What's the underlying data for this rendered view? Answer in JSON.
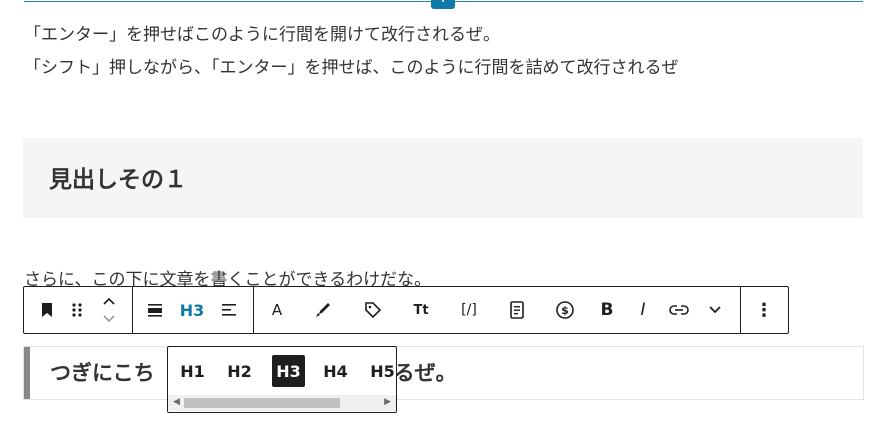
{
  "insert_button": {
    "label": "+"
  },
  "paragraphs": {
    "p1": "「エンター」を押せばこのように行間を開けて改行されるぜ。",
    "p2": "「シフト」押しながら、「エンター」を押せば、このように行間を詰めて改行されるぜ",
    "p3": "さらに、この下に文章を書くことができるわけだな。"
  },
  "headings": {
    "h1_text": "見出しその１",
    "h2_visible_left": "つぎにこち",
    "h2_visible_right": "するぜ。"
  },
  "toolbar": {
    "heading_level": "H3",
    "text_button": "A",
    "typography_button": "Tt",
    "shortcode_button": "[/]",
    "bold": "B",
    "italic": "I",
    "more": "⋮"
  },
  "level_popover": {
    "options": [
      "H1",
      "H2",
      "H3",
      "H4",
      "H5"
    ],
    "selected": "H3"
  },
  "colors": {
    "accent": "#0f7aa8",
    "toolbar_border": "#1e1e1e",
    "heading_bg": "#f4f5f7"
  },
  "icons": {
    "bookmark": "bookmark-icon",
    "drag": "drag-handle-icon",
    "move": "move-up-down-icon",
    "align": "align-icon",
    "text_align": "text-align-icon",
    "highlight": "highlighter-icon",
    "tag": "tag-icon",
    "file": "document-icon",
    "dollar": "dollar-circle-icon",
    "link": "link-icon",
    "chevron": "chevron-down-icon",
    "options": "more-options-icon"
  }
}
